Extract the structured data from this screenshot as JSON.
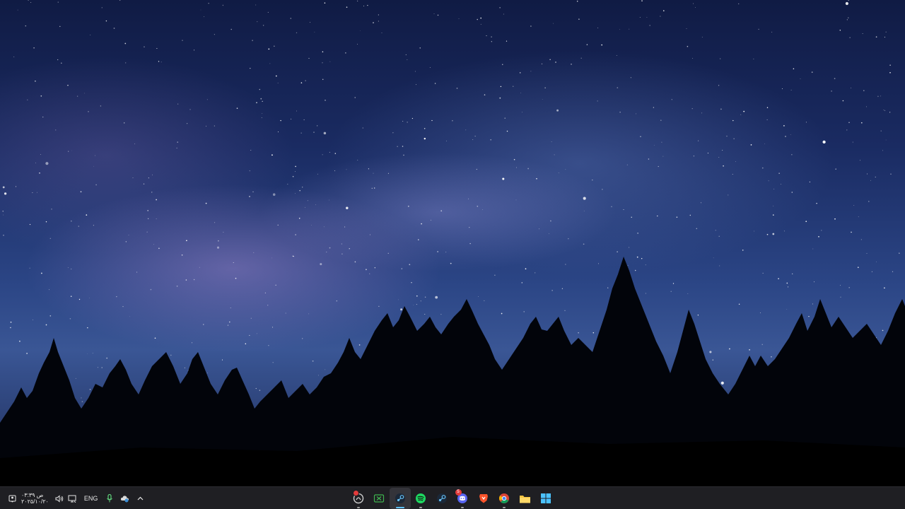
{
  "taskbar": {
    "clock": {
      "time": "۰۳:۳۹ ص",
      "date": "۲۰۲۵/۱۰/۲۰"
    },
    "language": "ENG",
    "tray_icons": [
      "notification-icon",
      "volume-icon",
      "monitor-icon",
      "microphone-icon",
      "cloud-sync-icon",
      "chevron-up-icon"
    ],
    "apps": [
      {
        "name": "app-unknown-1",
        "badge": "dot"
      },
      {
        "name": "xbox-game-bar"
      },
      {
        "name": "steam",
        "active": true
      },
      {
        "name": "spotify"
      },
      {
        "name": "steam-alt"
      },
      {
        "name": "discord",
        "badge_count": "5"
      },
      {
        "name": "brave"
      },
      {
        "name": "chrome"
      },
      {
        "name": "file-explorer"
      },
      {
        "name": "windows-start"
      }
    ]
  },
  "colors": {
    "taskbar_bg": "#1f1f23",
    "active_indicator": "#5ec2ff",
    "spotify": "#1ed760",
    "discord": "#5865f2",
    "brave": "#fb542b",
    "steam": "#66c0f4",
    "folder": "#f5c542",
    "windows": "#4cc2ff"
  }
}
